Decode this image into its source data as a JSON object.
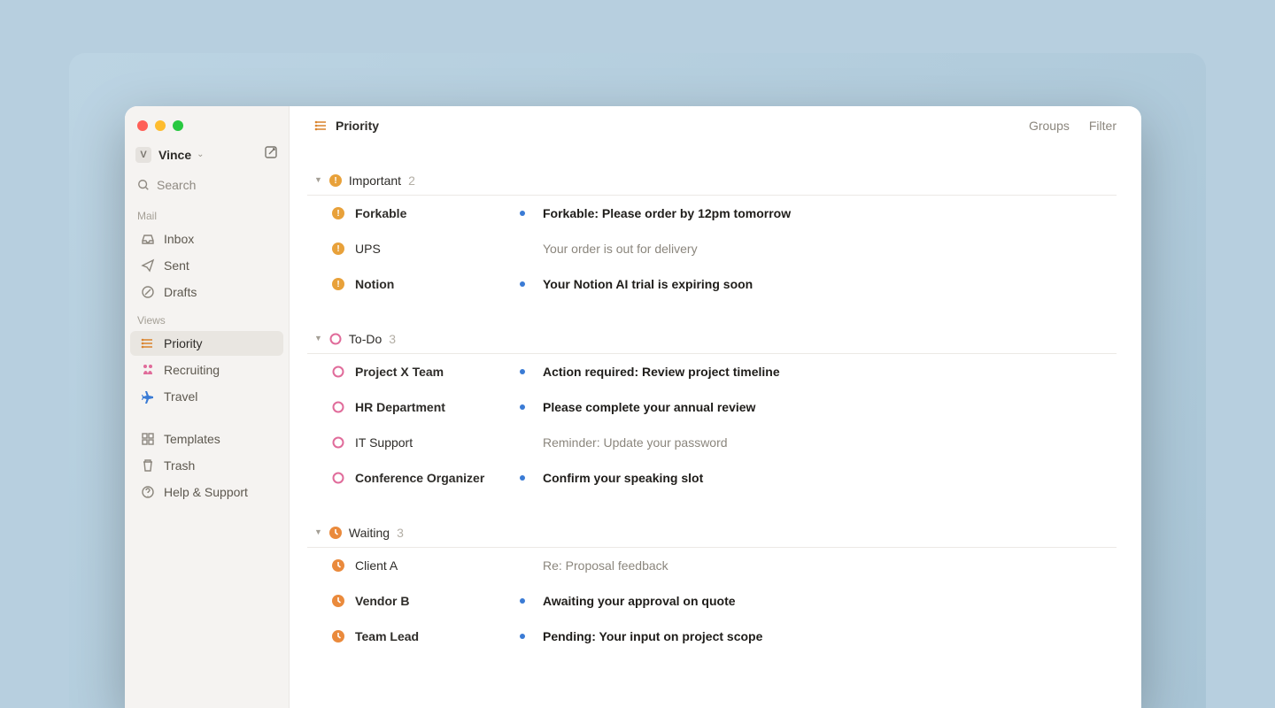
{
  "account": {
    "initial": "V",
    "name": "Vince"
  },
  "search": {
    "placeholder": "Search"
  },
  "sections": {
    "mail_label": "Mail",
    "views_label": "Views"
  },
  "nav": {
    "mail": [
      {
        "id": "inbox",
        "label": "Inbox"
      },
      {
        "id": "sent",
        "label": "Sent"
      },
      {
        "id": "drafts",
        "label": "Drafts"
      }
    ],
    "views": [
      {
        "id": "priority",
        "label": "Priority",
        "active": true
      },
      {
        "id": "recruiting",
        "label": "Recruiting"
      },
      {
        "id": "travel",
        "label": "Travel"
      }
    ],
    "footer": [
      {
        "id": "templates",
        "label": "Templates"
      },
      {
        "id": "trash",
        "label": "Trash"
      },
      {
        "id": "help",
        "label": "Help & Support"
      }
    ]
  },
  "header": {
    "title": "Priority",
    "actions": {
      "groups": "Groups",
      "filter": "Filter"
    }
  },
  "groups": [
    {
      "id": "important",
      "name": "Important",
      "count": 2,
      "icon": "important",
      "items": [
        {
          "sender": "Forkable",
          "subject": "Forkable: Please order by 12pm tomorrow",
          "unread": true
        },
        {
          "sender": "UPS",
          "subject": "Your order is out for delivery",
          "unread": false
        },
        {
          "sender": "Notion",
          "subject": "Your Notion AI trial is expiring soon",
          "unread": true
        }
      ]
    },
    {
      "id": "todo",
      "name": "To-Do",
      "count": 3,
      "icon": "todo",
      "items": [
        {
          "sender": "Project X Team",
          "subject": "Action required: Review project timeline",
          "unread": true
        },
        {
          "sender": "HR Department",
          "subject": "Please complete your annual review",
          "unread": true
        },
        {
          "sender": "IT Support",
          "subject": "Reminder: Update your password",
          "unread": false
        },
        {
          "sender": "Conference Organizer",
          "subject": "Confirm your speaking slot",
          "unread": true
        }
      ]
    },
    {
      "id": "waiting",
      "name": "Waiting",
      "count": 3,
      "icon": "waiting",
      "items": [
        {
          "sender": "Client A",
          "subject": "Re: Proposal feedback",
          "unread": false
        },
        {
          "sender": "Vendor B",
          "subject": "Awaiting your approval on quote",
          "unread": true
        },
        {
          "sender": "Team Lead",
          "subject": "Pending: Your input on project scope",
          "unread": true
        }
      ]
    }
  ]
}
